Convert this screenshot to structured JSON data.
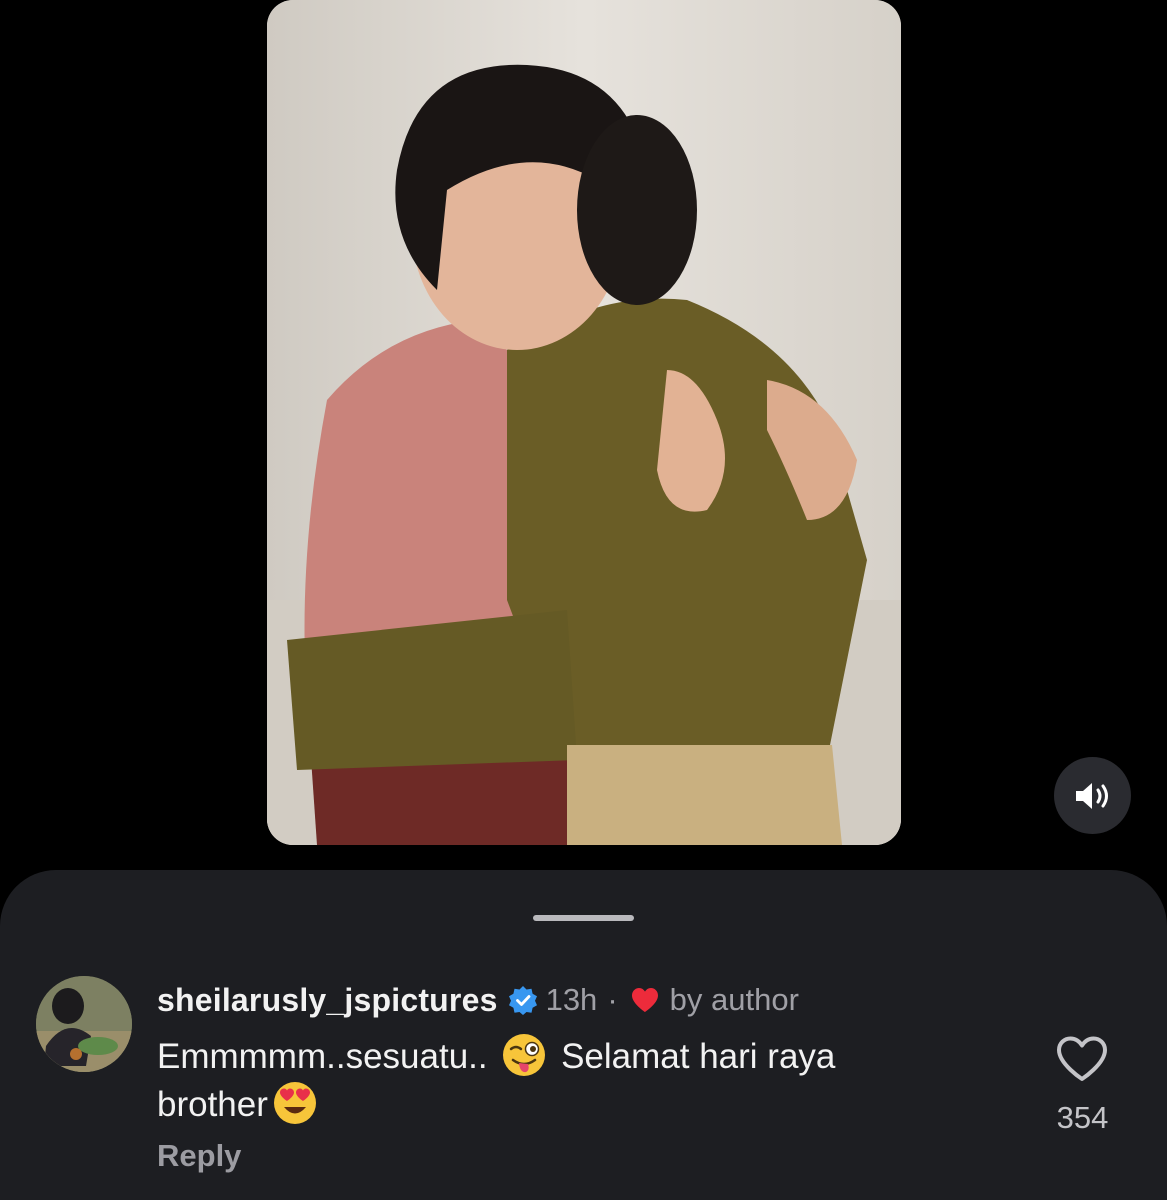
{
  "video": {
    "mute_icon": "speaker-on-icon"
  },
  "comment": {
    "username": "sheilarusly_jspictures",
    "verified": true,
    "timestamp": "13h",
    "separator": "·",
    "liked_by_author_label": "by author",
    "text_part1": "Emmmmm..sesuatu..",
    "text_part2": "Selamat hari raya",
    "text_part3": "brother",
    "emoji_1": "winking-face-with-tongue",
    "emoji_2": "smiling-face-with-heart-eyes",
    "reply_label": "Reply",
    "like_count": "354"
  },
  "colors": {
    "background": "#000000",
    "sheet": "#1d1e22",
    "verified_blue": "#3897f0",
    "heart_red": "#ed2b3b"
  }
}
